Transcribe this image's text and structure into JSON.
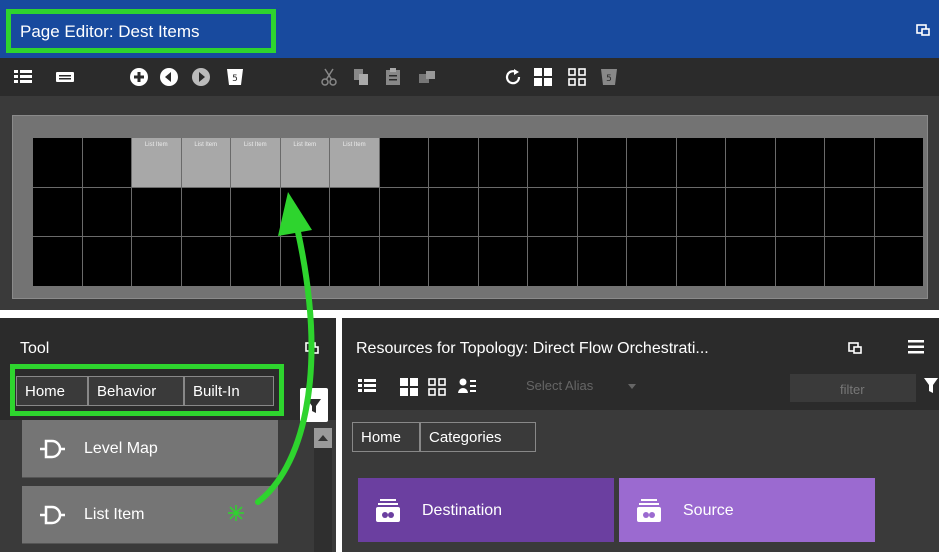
{
  "editor": {
    "title": "Page Editor: Dest Items",
    "grid_item_label": "List Item"
  },
  "tool": {
    "title": "Tool",
    "breadcrumb": [
      "Home",
      "Behavior",
      "Built-In"
    ],
    "items": [
      {
        "label": "Level Map"
      },
      {
        "label": "List Item"
      }
    ]
  },
  "resources": {
    "title": "Resources for Topology: Direct Flow Orchestrati...",
    "alias_placeholder": "Select Alias",
    "filter_placeholder": "filter",
    "breadcrumb": [
      "Home",
      "Categories"
    ],
    "categories": [
      {
        "label": "Destination",
        "color": "#6b3fa0"
      },
      {
        "label": "Source",
        "color": "#9b6ad0"
      }
    ]
  },
  "colors": {
    "title_bar": "#184a9e",
    "highlight": "#2ed42e",
    "panel_bg": "#3a3a3a"
  }
}
